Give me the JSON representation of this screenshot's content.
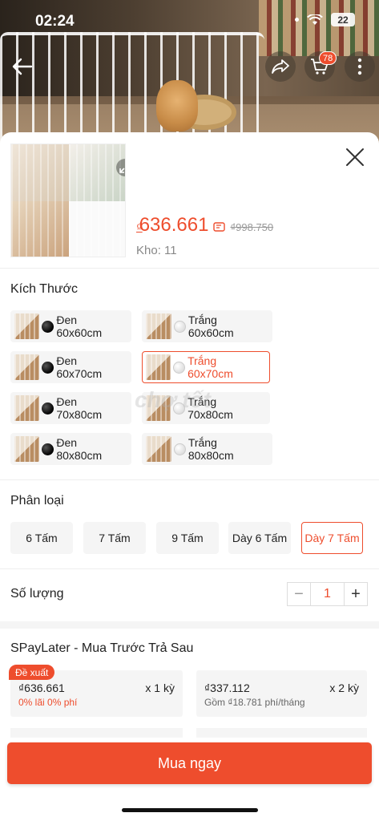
{
  "status_bar": {
    "time": "02:24",
    "battery": "22"
  },
  "nav": {
    "back_icon": "arrow-left-icon",
    "share_icon": "share-icon",
    "cart_icon": "cart-icon",
    "cart_badge": "78",
    "more_icon": "more-vertical-icon"
  },
  "product": {
    "currency": "₫",
    "price": "636.661",
    "old_price": "₫998.750",
    "stock": "Kho: 11"
  },
  "size": {
    "title": "Kích Thước",
    "options": [
      {
        "label": "Đen 60x60cm",
        "color": "black",
        "selected": false
      },
      {
        "label": "Trắng 60x60cm",
        "color": "white",
        "selected": false
      },
      {
        "label": "Đen 60x70cm",
        "color": "black",
        "selected": false
      },
      {
        "label": "Trắng 60x70cm",
        "color": "white",
        "selected": true
      },
      {
        "label": "Đen 70x80cm",
        "color": "black",
        "selected": false
      },
      {
        "label": "Trắng 70x80cm",
        "color": "white",
        "selected": false
      },
      {
        "label": "Đen 80x80cm",
        "color": "black",
        "selected": false
      },
      {
        "label": "Trắng 80x80cm",
        "color": "white",
        "selected": false
      }
    ]
  },
  "type": {
    "title": "Phân loại",
    "options": [
      {
        "label": "6 Tấm",
        "selected": false
      },
      {
        "label": "7 Tấm",
        "selected": false
      },
      {
        "label": "9 Tấm",
        "selected": false
      },
      {
        "label": "Dày 6 Tấm",
        "selected": false
      },
      {
        "label": "Dày 7 Tấm",
        "selected": true
      }
    ]
  },
  "quantity": {
    "title": "Số lượng",
    "minus": "−",
    "value": "1",
    "plus": "+"
  },
  "paylater": {
    "title": "SPayLater - Mua Trước Trả Sau",
    "badge": "Đề xuất",
    "plans": [
      {
        "amount": "₫636.661",
        "term": "x 1 kỳ",
        "note": "0% lãi 0% phí",
        "note_color": "#ee4d2d"
      },
      {
        "amount": "₫337.112",
        "term": "x 2 kỳ",
        "note": "Gồm ₫18.781 phí/tháng",
        "note_color": "#666666"
      }
    ]
  },
  "buy_button": "Mua ngay",
  "watermark": "chợ tốt",
  "colors": {
    "accent": "#ee4d2d",
    "option_bg": "#f5f5f5"
  }
}
